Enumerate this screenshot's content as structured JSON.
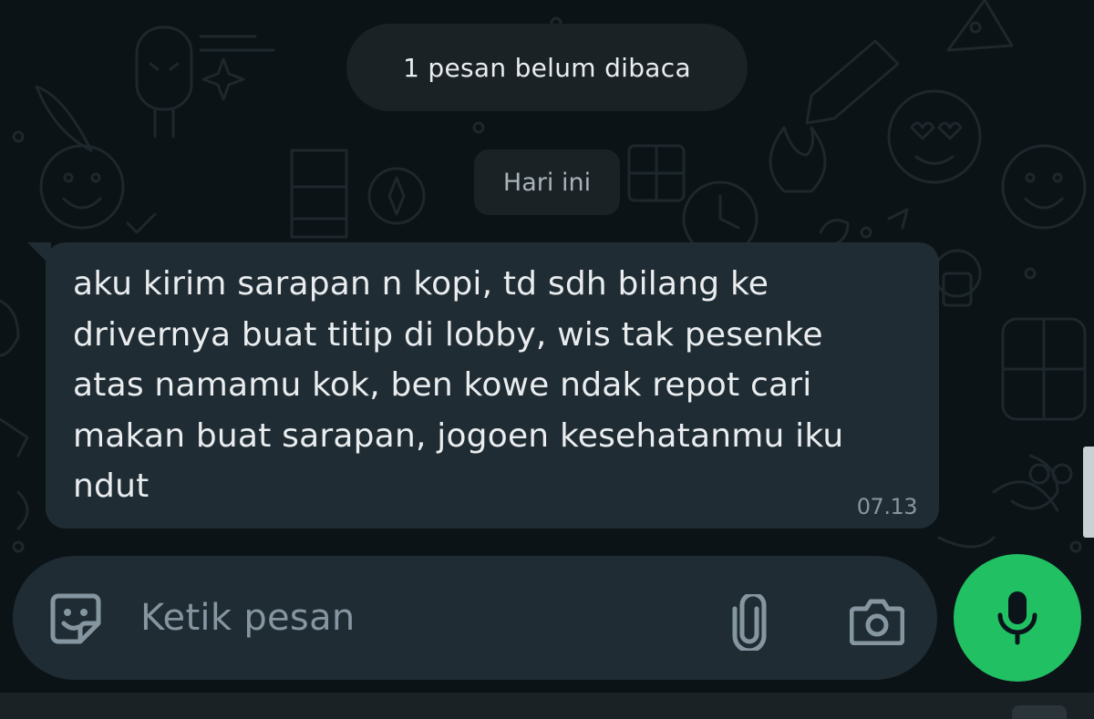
{
  "chat": {
    "unread_banner": "1 pesan belum dibaca",
    "date_divider": "Hari ini",
    "messages": [
      {
        "direction": "incoming",
        "text": "aku kirim sarapan n kopi, td sdh bilang ke\ndrivernya buat titip di lobby, wis tak pesenke\natas namamu kok, ben kowe ndak repot cari\nmakan buat sarapan, jogoen kesehatanmu iku\nndut",
        "time": "07.13"
      }
    ]
  },
  "composer": {
    "placeholder": "Ketik pesan",
    "icons": {
      "sticker": "sticker-icon",
      "attach": "paperclip-icon",
      "camera": "camera-icon",
      "mic": "microphone-icon"
    }
  },
  "theme": {
    "background": "#0c1317",
    "bubble_incoming": "#202c33",
    "mic_button": "#21c063",
    "text_primary": "#e9edef",
    "text_secondary": "#8696a0"
  }
}
